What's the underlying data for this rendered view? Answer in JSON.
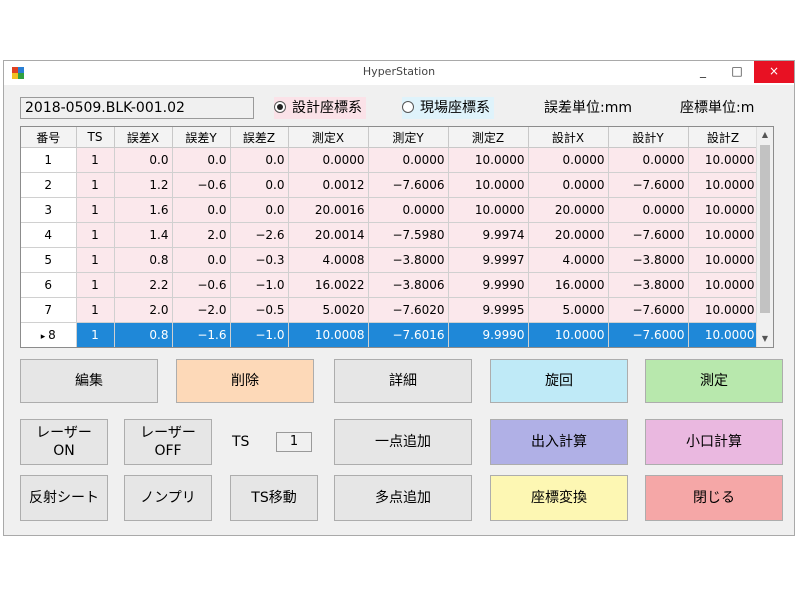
{
  "window": {
    "title": "HyperStation",
    "min": "_",
    "max": "□",
    "close": "×"
  },
  "top": {
    "file_name": "2018-0509.BLK-001.02",
    "radio_design": "設計座標系",
    "radio_field": "現場座標系",
    "error_unit": "誤差単位:mm",
    "coord_unit": "座標単位:m"
  },
  "grid": {
    "headers": [
      "番号",
      "TS",
      "誤差X",
      "誤差Y",
      "誤差Z",
      "測定X",
      "測定Y",
      "測定Z",
      "設計X",
      "設計Y",
      "設計Z"
    ],
    "rows": [
      [
        "1",
        "1",
        "0.0",
        "0.0",
        "0.0",
        "0.0000",
        "0.0000",
        "10.0000",
        "0.0000",
        "0.0000",
        "10.0000"
      ],
      [
        "2",
        "1",
        "1.2",
        "−0.6",
        "0.0",
        "0.0012",
        "−7.6006",
        "10.0000",
        "0.0000",
        "−7.6000",
        "10.0000"
      ],
      [
        "3",
        "1",
        "1.6",
        "0.0",
        "0.0",
        "20.0016",
        "0.0000",
        "10.0000",
        "20.0000",
        "0.0000",
        "10.0000"
      ],
      [
        "4",
        "1",
        "1.4",
        "2.0",
        "−2.6",
        "20.0014",
        "−7.5980",
        "9.9974",
        "20.0000",
        "−7.6000",
        "10.0000"
      ],
      [
        "5",
        "1",
        "0.8",
        "0.0",
        "−0.3",
        "4.0008",
        "−3.8000",
        "9.9997",
        "4.0000",
        "−3.8000",
        "10.0000"
      ],
      [
        "6",
        "1",
        "2.2",
        "−0.6",
        "−1.0",
        "16.0022",
        "−3.8006",
        "9.9990",
        "16.0000",
        "−3.8000",
        "10.0000"
      ],
      [
        "7",
        "1",
        "2.0",
        "−2.0",
        "−0.5",
        "5.0020",
        "−7.6020",
        "9.9995",
        "5.0000",
        "−7.6000",
        "10.0000"
      ],
      [
        "8",
        "1",
        "0.8",
        "−1.6",
        "−1.0",
        "10.0008",
        "−7.6016",
        "9.9990",
        "10.0000",
        "−7.6000",
        "10.0000"
      ]
    ]
  },
  "buttons": {
    "edit": "編集",
    "delete": "削除",
    "detail": "詳細",
    "rotate": "旋回",
    "measure": "測定",
    "laser_on_1": "レーザー",
    "laser_on_2": "ON",
    "laser_off_1": "レーザー",
    "laser_off_2": "OFF",
    "ts_label": "TS",
    "ts_value": "1",
    "add_one": "一点追加",
    "io_calc": "出入計算",
    "small_calc": "小口計算",
    "reflect_sheet": "反射シート",
    "no_prism": "ノンプリ",
    "ts_move": "TS移動",
    "add_multi": "多点追加",
    "coord_convert": "座標変換",
    "close": "閉じる"
  },
  "colors": {
    "delete": "#fdd9b8",
    "rotate": "#bfeaf7",
    "measure": "#b8e8ad",
    "io_calc": "#b0b0e6",
    "small_calc": "#eab8e0",
    "coord_convert": "#fdf7b3",
    "close": "#f5a7a7",
    "selected_row": "#1f88d8",
    "row_bg": "#fbe8ec"
  }
}
